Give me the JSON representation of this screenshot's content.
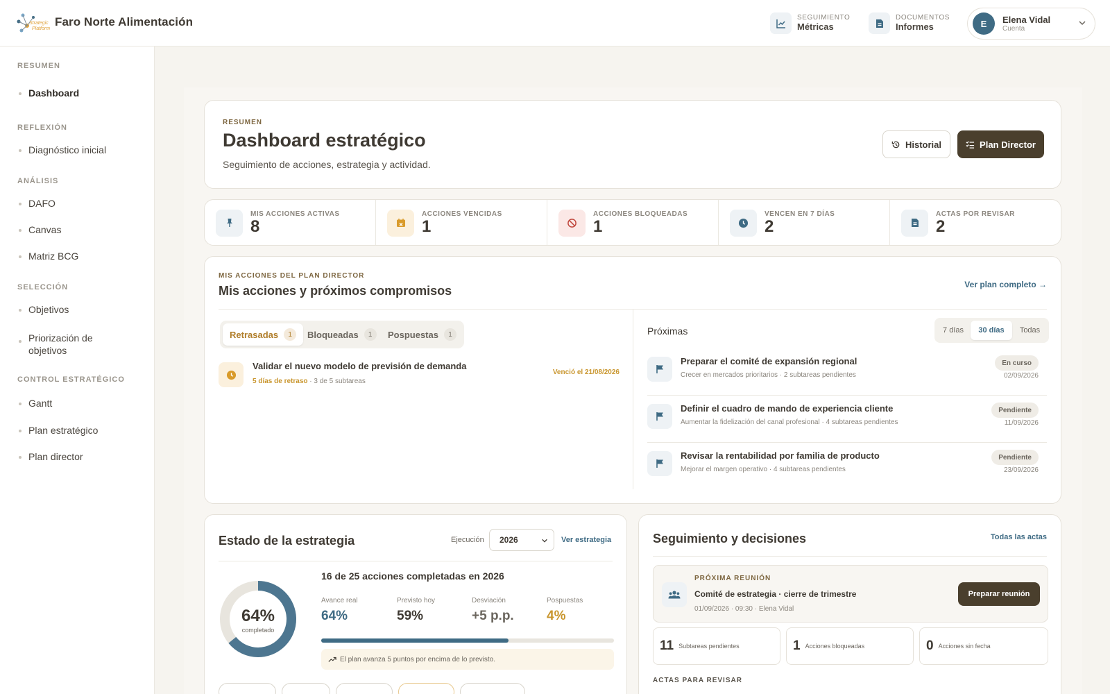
{
  "header": {
    "company": "Faro Norte Alimentación",
    "nav": [
      {
        "small": "SEGUIMIENTO",
        "big": "Métricas",
        "icon": "chart-line-icon"
      },
      {
        "small": "DOCUMENTOS",
        "big": "Informes",
        "icon": "document-icon"
      }
    ],
    "user": {
      "initial": "E",
      "name": "Elena Vidal",
      "sub": "Cuenta"
    }
  },
  "sidebar": {
    "sections": [
      {
        "title": "RESUMEN",
        "items": [
          "Dashboard"
        ]
      },
      {
        "title": "REFLEXIÓN",
        "items": [
          "Diagnóstico inicial"
        ]
      },
      {
        "title": "ANÁLISIS",
        "items": [
          "DAFO",
          "Canvas",
          "Matriz BCG"
        ]
      },
      {
        "title": "SELECCIÓN",
        "items": [
          "Objetivos",
          "Priorización de objetivos"
        ]
      },
      {
        "title": "CONTROL ESTRATÉGICO",
        "items": [
          "Gantt",
          "Plan estratégico",
          "Plan director"
        ]
      }
    ]
  },
  "hero": {
    "eyebrow": "RESUMEN",
    "title": "Dashboard estratégico",
    "subtitle": "Seguimiento de acciones, estrategia y actividad.",
    "history_label": "Historial",
    "plan_label": "Plan Director"
  },
  "kpis": [
    {
      "label": "MIS ACCIONES ACTIVAS",
      "value": "8",
      "color": "#eef2f5",
      "icon": "pin-icon"
    },
    {
      "label": "ACCIONES VENCIDAS",
      "value": "1",
      "color": "#fbf0dd",
      "icon": "calendar-x-icon"
    },
    {
      "label": "ACCIONES BLOQUEADAS",
      "value": "1",
      "color": "#fbe8e6",
      "icon": "blocked-icon"
    },
    {
      "label": "VENCEN EN 7 DÍAS",
      "value": "2",
      "color": "#eef2f5",
      "icon": "clock-icon"
    },
    {
      "label": "ACTAS POR REVISAR",
      "value": "2",
      "color": "#eef2f5",
      "icon": "document-icon"
    }
  ],
  "actions": {
    "eyebrow": "MIS ACCIONES DEL PLAN DIRECTOR",
    "title": "Mis acciones y próximos compromisos",
    "see_all": "Ver plan completo →",
    "tabs": [
      {
        "label": "Retrasadas",
        "count": "1"
      },
      {
        "label": "Bloqueadas",
        "count": "1"
      },
      {
        "label": "Pospuestas",
        "count": "1"
      }
    ],
    "overdue": {
      "title": "Validar el nuevo modelo de previsión de demanda",
      "delay": "5 días de retraso",
      "meta": "· 3 de 5 subtareas",
      "due": "Venció el 21/08/2026"
    },
    "upcoming_title": "Próximas",
    "ranges": [
      "7 días",
      "30 días",
      "Todas"
    ],
    "upcoming": [
      {
        "title": "Preparar el comité de expansión regional",
        "sub": "Crecer en mercados prioritarios · 2 subtareas pendientes",
        "status": "En curso",
        "date": "02/09/2026"
      },
      {
        "title": "Definir el cuadro de mando de experiencia cliente",
        "sub": "Aumentar la fidelización del canal profesional · 4 subtareas pendientes",
        "status": "Pendiente",
        "date": "11/09/2026"
      },
      {
        "title": "Revisar la rentabilidad por familia de producto",
        "sub": "Mejorar el margen operativo · 4 subtareas pendientes",
        "status": "Pendiente",
        "date": "23/09/2026"
      }
    ]
  },
  "strategy": {
    "title": "Estado de la estrategia",
    "exec_label": "Ejecución",
    "year": "2026",
    "see_link": "Ver estrategia",
    "summary": "16 de 25 acciones completadas en 2026",
    "donut_value": "64%",
    "donut_label": "completado",
    "progress": 0.64,
    "forecast": 0.59,
    "stats": [
      {
        "label": "Avance real",
        "value": "64%",
        "color": "#3f6b84"
      },
      {
        "label": "Previsto hoy",
        "value": "59%",
        "color": "#3f3a33"
      },
      {
        "label": "Desviación",
        "value": "+5 p.p.",
        "color": "#6b665e"
      },
      {
        "label": "Pospuestas",
        "value": "4%",
        "color": "#c9962e"
      }
    ],
    "note": "El plan avanza 5 puntos por encima de lo previsto."
  },
  "decisions": {
    "title": "Seguimiento y decisiones",
    "all_link": "Todas las actas",
    "meeting_eyebrow": "PRÓXIMA REUNIÓN",
    "meeting_title": "Comité de estrategia · cierre de trimestre",
    "meeting_meta": "01/09/2026 · 09:30 · Elena Vidal",
    "prepare_label": "Preparar reunión",
    "minis": [
      {
        "value": "11",
        "label": "Subtareas pendientes"
      },
      {
        "value": "1",
        "label": "Acciones bloqueadas"
      },
      {
        "value": "0",
        "label": "Acciones sin fecha"
      }
    ],
    "actas_title": "ACTAS PARA REVISAR"
  }
}
